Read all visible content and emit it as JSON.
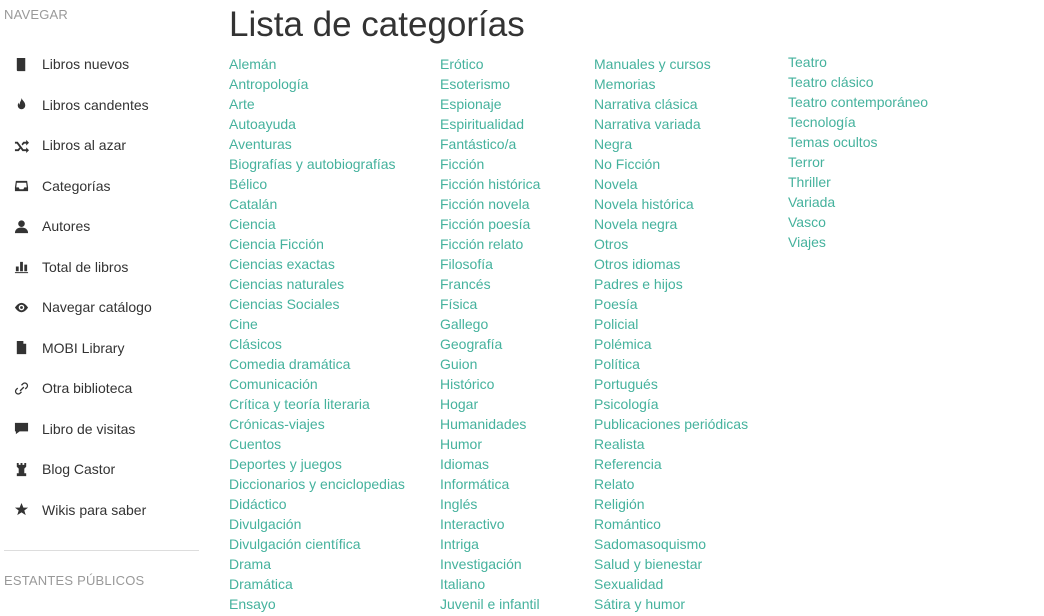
{
  "sidebar": {
    "header": "NAVEGAR",
    "items": [
      {
        "label": "Libros nuevos",
        "icon": "book-icon"
      },
      {
        "label": "Libros candentes",
        "icon": "fire-icon"
      },
      {
        "label": "Libros al azar",
        "icon": "shuffle-icon"
      },
      {
        "label": "Categorías",
        "icon": "inbox-icon"
      },
      {
        "label": "Autores",
        "icon": "user-icon"
      },
      {
        "label": "Total de libros",
        "icon": "bar-chart-icon"
      },
      {
        "label": "Navegar catálogo",
        "icon": "eye-icon"
      },
      {
        "label": "MOBI Library",
        "icon": "file-icon"
      },
      {
        "label": "Otra biblioteca",
        "icon": "link-icon"
      },
      {
        "label": "Libro de visitas",
        "icon": "comment-icon"
      },
      {
        "label": "Blog Castor",
        "icon": "tower-icon"
      },
      {
        "label": "Wikis para saber",
        "icon": "star-icon"
      }
    ],
    "shelves_header": "ESTANTES PÚBLICOS"
  },
  "main": {
    "title": "Lista de categorías",
    "columns": [
      [
        "Alemán",
        "Antropología",
        "Arte",
        "Autoayuda",
        "Aventuras",
        "Biografías y autobiografías",
        "Bélico",
        "Catalán",
        "Ciencia",
        "Ciencia Ficción",
        "Ciencias exactas",
        "Ciencias naturales",
        "Ciencias Sociales",
        "Cine",
        "Clásicos",
        "Comedia dramática",
        "Comunicación",
        "Crítica y teoría literaria",
        "Crónicas-viajes",
        "Cuentos",
        "Deportes y juegos",
        "Diccionarios y enciclopedias",
        "Didáctico",
        "Divulgación",
        "Divulgación científica",
        "Drama",
        "Dramática",
        "Ensayo"
      ],
      [
        "Erótico",
        "Esoterismo",
        "Espionaje",
        "Espiritualidad",
        "Fantástico/a",
        "Ficción",
        "Ficción histórica",
        "Ficción novela",
        "Ficción poesía",
        "Ficción relato",
        "Filosofía",
        "Francés",
        "Física",
        "Gallego",
        "Geografía",
        "Guion",
        "Histórico",
        "Hogar",
        "Humanidades",
        "Humor",
        "Idiomas",
        "Informática",
        "Inglés",
        "Interactivo",
        "Intriga",
        "Investigación",
        "Italiano",
        "Juvenil e infantil"
      ],
      [
        "Manuales y cursos",
        "Memorias",
        "Narrativa clásica",
        "Narrativa variada",
        "Negra",
        "No Ficción",
        "Novela",
        "Novela histórica",
        "Novela negra",
        "Otros",
        "Otros idiomas",
        "Padres e hijos",
        "Poesía",
        "Policial",
        "Polémica",
        "Política",
        "Portugués",
        "Psicología",
        "Publicaciones periódicas",
        "Realista",
        "Referencia",
        "Relato",
        "Religión",
        "Romántico",
        "Sadomasoquismo",
        "Salud y bienestar",
        "Sexualidad",
        "Sátira y humor"
      ],
      [
        "Teatro",
        "Teatro clásico",
        "Teatro contemporáneo",
        "Tecnología",
        "Temas ocultos",
        "Terror",
        "Thriller",
        "Variada",
        "Vasco",
        "Viajes"
      ]
    ]
  },
  "colors": {
    "link": "#45b29d",
    "text": "#333333",
    "muted": "#999999"
  }
}
